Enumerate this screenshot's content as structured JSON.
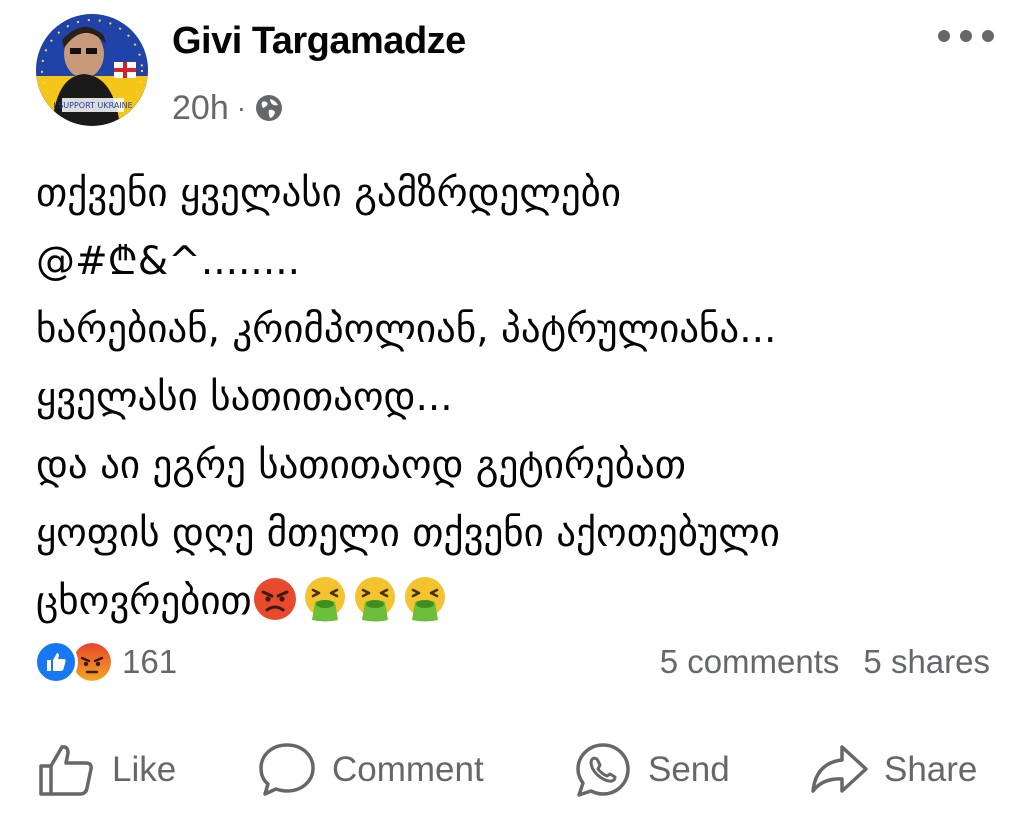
{
  "post": {
    "author": "Givi Targamadze",
    "timestamp": "20h",
    "separator": "·",
    "audience_icon": "globe-icon",
    "avatar_badge": "I SUPPORT UKRAINE",
    "more_icon": "more-options-icon",
    "lines": [
      "თქვენი ყველასი გამზრდელები",
      "@#₾&^........",
      "ხარებიან, კრიმპოლიან, პატრულიანა...",
      "ყველასი სათითაოდ...",
      "და აი ეგრე სათითაოდ გეტირებათ",
      "ყოფის დღე მთელი თქვენი აქოთებული",
      "ცხოვრებით"
    ],
    "trailing_emojis": [
      "angry-face",
      "vomiting-face",
      "vomiting-face",
      "vomiting-face"
    ]
  },
  "reactions": {
    "types": [
      "like",
      "angry"
    ],
    "count": "161"
  },
  "stats": {
    "comments": "5 comments",
    "shares": "5 shares"
  },
  "actions": {
    "like": "Like",
    "comment": "Comment",
    "send": "Send",
    "share": "Share"
  },
  "colors": {
    "text": "#050505",
    "secondary": "#65676b",
    "like_blue": "#1877f2",
    "angry_orange": "#f07a1a"
  }
}
